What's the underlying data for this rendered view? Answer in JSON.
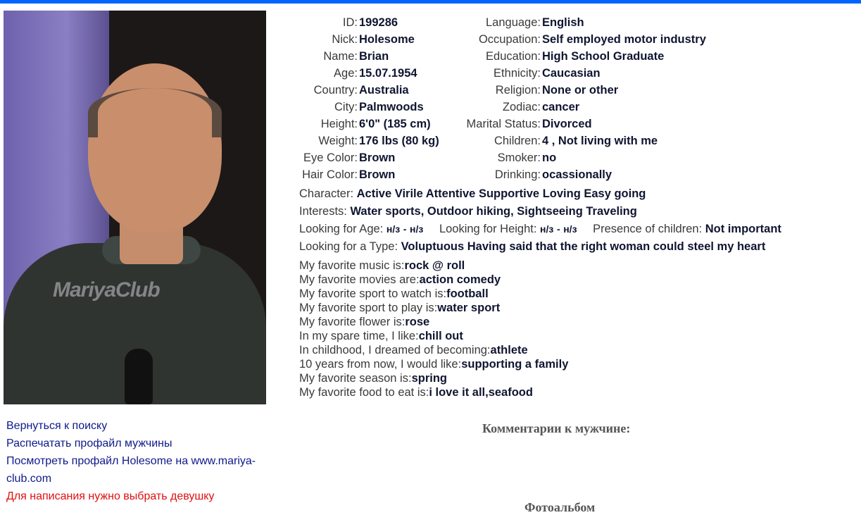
{
  "colors": {
    "top_bar": "#0066ff",
    "link": "#0e1a8a",
    "warning": "#e01010"
  },
  "photo": {
    "watermark": "MariyaClub"
  },
  "profile_left": [
    {
      "label": "ID:",
      "value": "199286"
    },
    {
      "label": "Nick:",
      "value": "Holesome"
    },
    {
      "label": "Name:",
      "value": "Brian"
    },
    {
      "label": "Age:",
      "value": "15.07.1954"
    },
    {
      "label": "Country:",
      "value": "Australia"
    },
    {
      "label": "City:",
      "value": "Palmwoods"
    },
    {
      "label": "Height:",
      "value": "6'0\" (185 cm)"
    },
    {
      "label": "Weight:",
      "value": "176 lbs (80 kg)"
    },
    {
      "label": "Eye Color:",
      "value": "Brown"
    },
    {
      "label": "Hair Color:",
      "value": "Brown"
    }
  ],
  "profile_right": [
    {
      "label": "Language:",
      "value": "English"
    },
    {
      "label": "Occupation:",
      "value": "Self employed motor industry"
    },
    {
      "label": "Education:",
      "value": "High School Graduate"
    },
    {
      "label": "Ethnicity:",
      "value": "Caucasian"
    },
    {
      "label": "Religion:",
      "value": "None or other"
    },
    {
      "label": "Zodiac:",
      "value": "cancer"
    },
    {
      "label": "Marital Status:",
      "value": "Divorced"
    },
    {
      "label": "Children:",
      "value": "4 , Not living with me"
    },
    {
      "label": "Smoker:",
      "value": "no"
    },
    {
      "label": "Drinking:",
      "value": "ocassionally"
    }
  ],
  "character": {
    "label": "Character:",
    "value": "Active Virile Attentive Supportive Loving Easy going"
  },
  "interests": {
    "label": "Interests:",
    "value": "Water sports, Outdoor hiking, Sightseeing Traveling"
  },
  "looking": {
    "age_label": "Looking for Age:",
    "age_from": "н/з",
    "age_sep": "-",
    "age_to": "н/з",
    "height_label": "Looking for Height:",
    "height_from": "н/з",
    "height_sep": "-",
    "height_to": "н/з",
    "children_label": "Presence of children:",
    "children_value": "Not important"
  },
  "type": {
    "label": "Looking for a Type:",
    "value": "Voluptuous Having said that the right woman could steel my heart"
  },
  "favorites": [
    {
      "label": "My favorite music is:",
      "value": "rock @ roll"
    },
    {
      "label": "My favorite movies are:",
      "value": "action comedy"
    },
    {
      "label": "My favorite sport to watch is:",
      "value": "football"
    },
    {
      "label": "My favorite sport to play is:",
      "value": "water sport"
    },
    {
      "label": "My favorite flower is:",
      "value": "rose"
    },
    {
      "label": "In my spare time, I like:",
      "value": "chill out"
    },
    {
      "label": "In childhood, I dreamed of becoming:",
      "value": "athlete"
    },
    {
      "label": "10 years from now, I would like:",
      "value": "supporting a family"
    },
    {
      "label": "My favorite season is:",
      "value": "spring"
    },
    {
      "label": "My favorite food to eat is:",
      "value": "i love it all,seafood"
    }
  ],
  "links": {
    "back": "Вернуться к поиску",
    "print": "Распечатать профайл мужчины",
    "view": "Посмотреть профайл Holesome на www.mariya-club.com",
    "warning": "Для написания нужно выбрать девушку"
  },
  "comments_title": "Комментарии к мужчине:",
  "photoalbum_title": "Фотоальбом"
}
